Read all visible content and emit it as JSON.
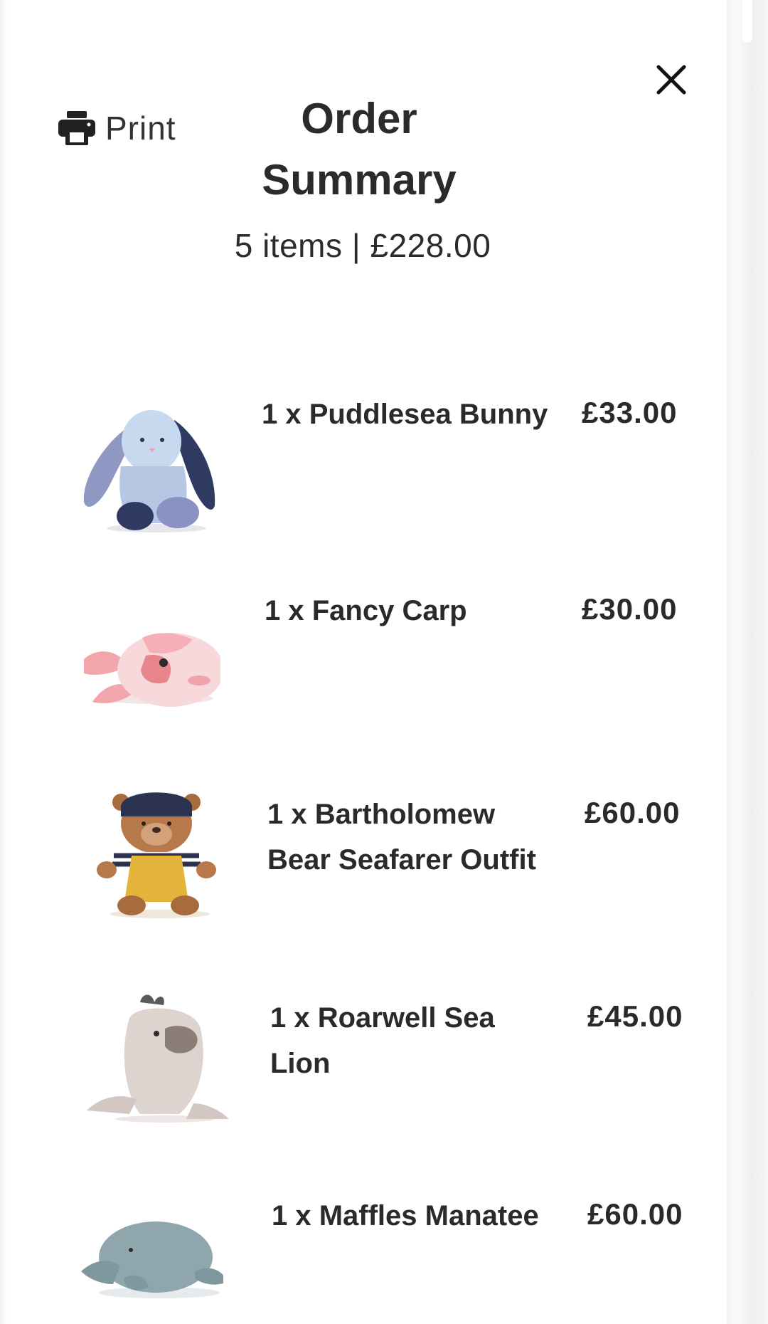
{
  "header": {
    "print_label": "Print",
    "title": "Order Summary",
    "summary": "5 items | £228.00"
  },
  "icons": {
    "close": "close-icon",
    "print": "printer-icon"
  },
  "items": [
    {
      "name": "1 x Puddlesea Bunny",
      "price": "£33.00",
      "image": "bunny-plush"
    },
    {
      "name": "1 x Fancy Carp",
      "price": "£30.00",
      "image": "carp-plush"
    },
    {
      "name": "1 x Bartholomew Bear Seafarer Outfit",
      "price": "£60.00",
      "image": "bear-plush"
    },
    {
      "name": "1 x Roarwell Sea Lion",
      "price": "£45.00",
      "image": "sea-lion-plush"
    },
    {
      "name": "1 x Maffles Manatee",
      "price": "£60.00",
      "image": "manatee-plush"
    }
  ],
  "colors": {
    "text": "#2a2a2a",
    "background": "#ffffff"
  }
}
